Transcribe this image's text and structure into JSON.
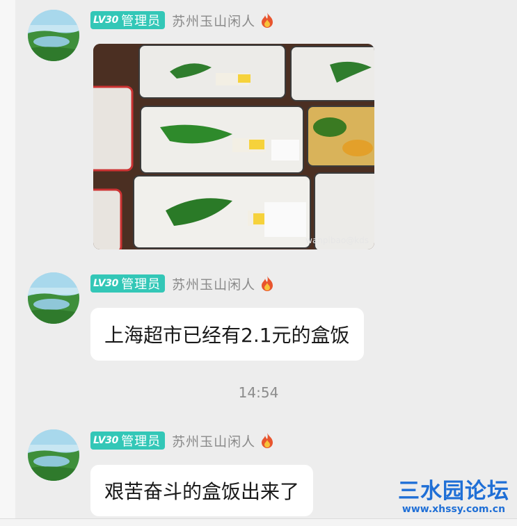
{
  "messages": [
    {
      "level": "LV30",
      "role": "管理员",
      "name": "苏州玉山闲人",
      "type": "image",
      "image": {
        "description_icon": "food-photo-icon",
        "watermark": "wanpibao@kds"
      }
    },
    {
      "level": "LV30",
      "role": "管理员",
      "name": "苏州玉山闲人",
      "type": "text",
      "text": "上海超市已经有2.1元的盒饭"
    },
    {
      "level": "LV30",
      "role": "管理员",
      "name": "苏州玉山闲人",
      "type": "text",
      "text": "艰苦奋斗的盒饭出来了"
    }
  ],
  "timestamp": "14:54",
  "site_watermark": {
    "title": "三水园论坛",
    "url": "www.xhssy.com.cn"
  },
  "colors": {
    "badge": "#33c7b7",
    "background": "#ededed",
    "bubble": "#ffffff",
    "watermark": "#1f6fd6"
  }
}
